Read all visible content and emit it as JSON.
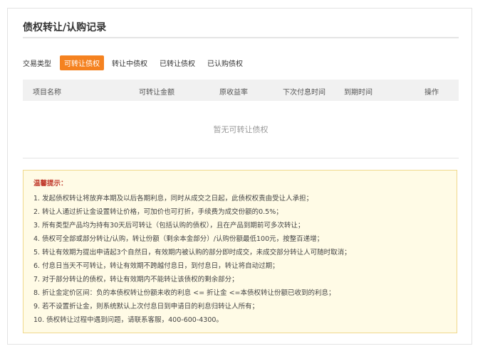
{
  "header": {
    "title": "债权转让/认购记录"
  },
  "filter": {
    "type_label": "交易类型",
    "tabs": [
      {
        "label": "可转让债权",
        "active": true
      },
      {
        "label": "转让中债权",
        "active": false
      },
      {
        "label": "已转让债权",
        "active": false
      },
      {
        "label": "已认购债权",
        "active": false
      }
    ]
  },
  "table": {
    "columns": [
      "项目名称",
      "可转让金额",
      "原收益率",
      "下次付息时间",
      "到期时间",
      "操作"
    ],
    "empty_text": "暂无可转让债权"
  },
  "tips": {
    "title": "温馨提示：",
    "items": [
      "1.  发起债权转让将放弃本期及以后各期利息，同时从成交之日起，此债权权责由受让人承担；",
      "2.  转让人通过折让金设置转让价格，可加价也可打折，手续费为成交份额的0.5%；",
      "3.  所有类型产品均为持有30天后可转让（包括认购的债权），且在产品到期前可多次转让；",
      "4.  债权可全部或部分转让/认购，转让份额（剩余本金部分）/认购份额最低100元，按整百递增；",
      "5.  转让有效期为提出申请起3个自然日，有效期内被认购的部分即时成交，未成交部分转让人可随时取消；",
      "6.  付息日当天不可转让，转让有效期不跨越付息日，到付息日，转让将自动过期；",
      "7.  对于部分转让的债权，转让有效期内不能转让该债权的剩余部分；",
      "8.  折让金定价区间：负的本债权转让份额未收的利息 <= 折让金 <=本债权转让份额已收到的利息；",
      "9.  若不设置折让金，则系统默认上次付息日到申请日的利息归转让人所有；",
      "10.  债权转让过程中遇到问题，请联系客服，400-600-4300。"
    ]
  },
  "colors": {
    "accent": "#f58220",
    "tips_bg": "#fffbe6",
    "tips_title": "#c0392b"
  }
}
